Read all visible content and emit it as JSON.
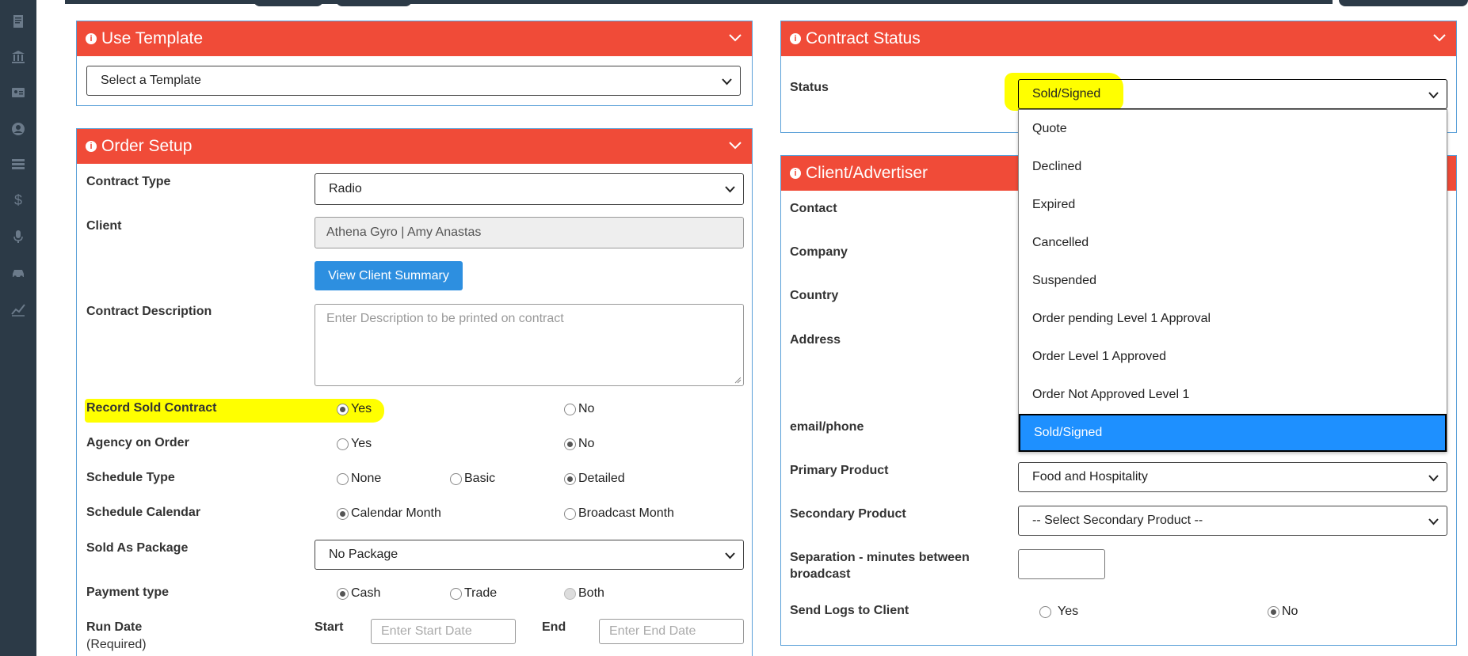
{
  "sidebar": {
    "icons": [
      "document-icon",
      "bank-icon",
      "id-card-icon",
      "user-circle-icon",
      "list-icon",
      "dollar-icon",
      "microphone-icon",
      "car-icon",
      "chart-line-icon"
    ]
  },
  "use_template": {
    "title": "Use Template",
    "select_value": "Select a Template"
  },
  "order_setup": {
    "title": "Order Setup",
    "contract_type_label": "Contract Type",
    "contract_type_value": "Radio",
    "client_label": "Client",
    "client_value": "Athena Gyro | Amy Anastas",
    "view_client_button": "View Client Summary",
    "contract_description_label": "Contract Description",
    "contract_description_placeholder": "Enter Description to be printed on contract",
    "record_sold_label": "Record Sold Contract",
    "record_sold_yes": "Yes",
    "record_sold_no": "No",
    "agency_label": "Agency on Order",
    "agency_yes": "Yes",
    "agency_no": "No",
    "schedule_type_label": "Schedule Type",
    "schedule_none": "None",
    "schedule_basic": "Basic",
    "schedule_detailed": "Detailed",
    "schedule_calendar_label": "Schedule Calendar",
    "calendar_month": "Calendar Month",
    "broadcast_month": "Broadcast Month",
    "sold_as_package_label": "Sold As Package",
    "sold_as_package_value": "No Package",
    "payment_type_label": "Payment type",
    "payment_cash": "Cash",
    "payment_trade": "Trade",
    "payment_both": "Both",
    "run_date_label": "Run Date",
    "run_date_required": "(Required)",
    "start_label": "Start",
    "start_placeholder": "Enter Start Date",
    "end_label": "End",
    "end_placeholder": "Enter End Date"
  },
  "contract_status": {
    "title": "Contract Status",
    "status_label": "Status",
    "status_value": "Sold/Signed",
    "options": [
      "Quote",
      "Declined",
      "Expired",
      "Cancelled",
      "Suspended",
      "Order pending Level 1 Approval",
      "Order Level 1 Approved",
      "Order Not Approved Level 1",
      "Sold/Signed"
    ],
    "selected_option": "Sold/Signed"
  },
  "client_advertiser": {
    "title": "Client/Advertiser",
    "contact_label": "Contact",
    "company_label": "Company",
    "country_label": "Country",
    "address_label": "Address",
    "email_phone_label": "email/phone",
    "primary_product_label": "Primary Product",
    "primary_product_value": "Food and Hospitality",
    "secondary_product_label": "Secondary Product",
    "secondary_product_value": "-- Select Secondary Product --",
    "separation_label_1": "Separation - minutes between",
    "separation_label_2": "broadcast",
    "send_logs_label": "Send Logs to Client",
    "send_logs_yes": "Yes",
    "send_logs_no": "No"
  },
  "colors": {
    "header_red": "#f04b38",
    "border_blue": "#5aa0d8",
    "button_blue": "#2d8fe0",
    "highlight_yellow": "#ffff00",
    "sidebar_dark": "#2c3a47",
    "dropdown_selected": "#1e90ff"
  }
}
